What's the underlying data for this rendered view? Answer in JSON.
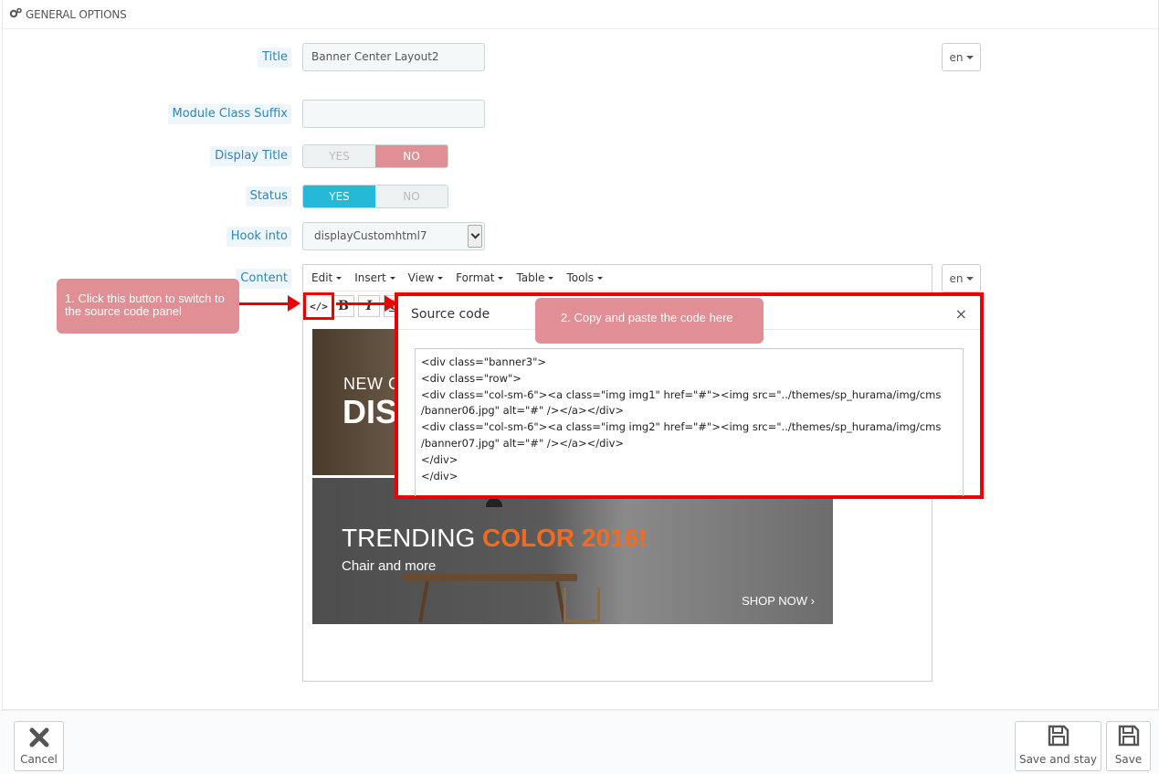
{
  "panel": {
    "heading": "General Options",
    "heading_icon": "cogs-icon"
  },
  "form": {
    "title": {
      "label": "Title",
      "value": "Banner Center Layout2",
      "lang": "en"
    },
    "module_class_suffix": {
      "label": "Module Class Suffix",
      "value": ""
    },
    "display_title": {
      "label": "Display Title",
      "yes": "YES",
      "no": "NO",
      "selected": "NO"
    },
    "status": {
      "label": "Status",
      "yes": "YES",
      "no": "NO",
      "selected": "YES"
    },
    "hook_into": {
      "label": "Hook into",
      "value": "displayCustomhtml7"
    },
    "content": {
      "label": "Content",
      "lang": "en"
    }
  },
  "editor": {
    "menus": [
      "Edit",
      "Insert",
      "View",
      "Format",
      "Table",
      "Tools"
    ],
    "toolbar": {
      "source_code": "</>",
      "bold": "B",
      "italic": "I",
      "underline": "U"
    },
    "banner1": {
      "line1": "NEW CO",
      "line2": "DIS"
    },
    "banner2": {
      "title_plain": "TRENDING ",
      "title_highlight": "COLOR 2016!",
      "subtitle": "Chair and more",
      "cta": "SHOP NOW ›"
    }
  },
  "modal": {
    "title": "Source code",
    "close": "×",
    "code": "<div class=\"banner3\">\n<div class=\"row\">\n<div class=\"col-sm-6\"><a class=\"img img1\" href=\"#\"><img src=\"../themes/sp_hurama/img/cms\n/banner06.jpg\" alt=\"#\" /></a></div>\n<div class=\"col-sm-6\"><a class=\"img img2\" href=\"#\"><img src=\"../themes/sp_hurama/img/cms\n/banner07.jpg\" alt=\"#\" /></a></div>\n</div>\n</div>"
  },
  "callouts": {
    "step1": "1. Click this button to switch to the source code panel",
    "step2": "2. Copy and paste the code here"
  },
  "footer": {
    "cancel": "Cancel",
    "save_and_stay": "Save and stay",
    "save": "Save"
  },
  "colors": {
    "label_bg": "#eef6fb",
    "label_text": "#2d86b4",
    "switch_no": "#e08f95",
    "switch_yes": "#25b9d7",
    "highlight": "#e00000",
    "callout": "#e08f95"
  }
}
